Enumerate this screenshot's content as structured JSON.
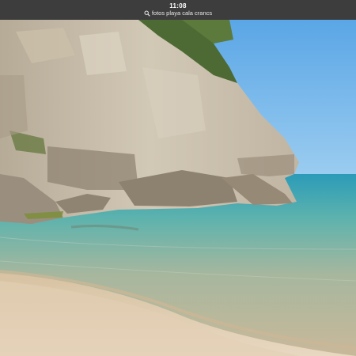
{
  "status_bar": {
    "time": "11:08",
    "url": "fotos playa cala crancs",
    "search_icon": "search-icon"
  },
  "photo": {
    "subject": "beach-rock-cliff-photo"
  }
}
